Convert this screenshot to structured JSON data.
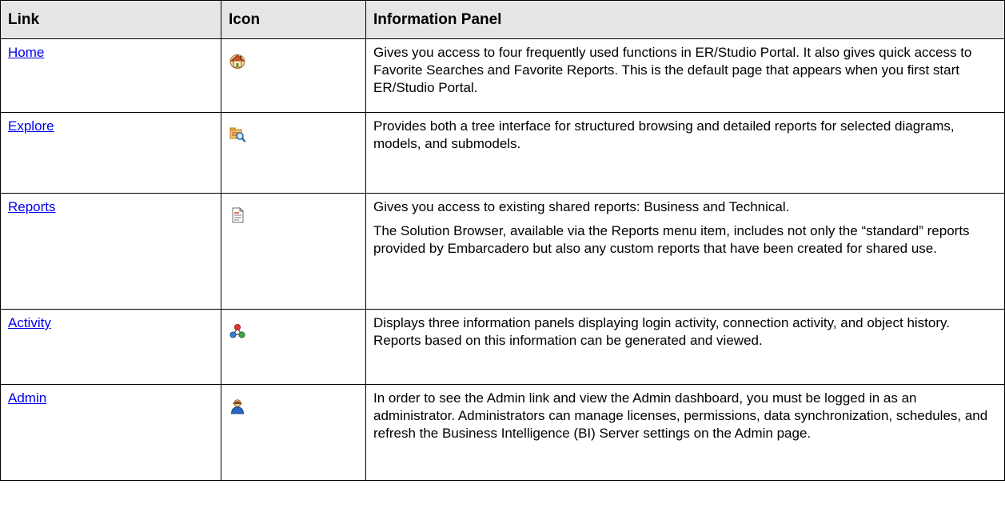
{
  "table": {
    "headers": {
      "link": "Link",
      "icon": "Icon",
      "info": "Information Panel"
    },
    "rows": [
      {
        "link": "Home",
        "icon": "home-icon",
        "info": [
          "Gives you access to four frequently used functions in ER/Studio Portal. It also gives quick access to Favorite Searches and Favorite Reports. This is the default page that appears when you first start ER/Studio Portal."
        ]
      },
      {
        "link": "Explore",
        "icon": "explore-icon",
        "info": [
          "Provides both a tree interface for structured browsing and detailed reports for selected diagrams, models, and submodels."
        ]
      },
      {
        "link": "Reports",
        "icon": "reports-icon",
        "info": [
          "Gives you access to existing shared reports: Business and Technical.",
          "The Solution Browser, available via the Reports menu item, includes not only the “standard” reports provided by Embarcadero but also any custom reports that have been created for shared use."
        ]
      },
      {
        "link": "Activity",
        "icon": "activity-icon",
        "info": [
          "Displays three information panels displaying login activity, connection activity, and object history. Reports based on this information can be generated and viewed."
        ]
      },
      {
        "link": "Admin",
        "icon": "admin-icon",
        "info": [
          "In order to see the Admin link and view the Admin dashboard, you must be logged in as an administrator. Administrators can manage licenses, permissions, data synchronization, schedules, and refresh the Business Intelligence (BI) Server settings on the Admin page."
        ]
      }
    ]
  },
  "colors": {
    "header_bg": "#e6e6e6",
    "link": "#0000ee",
    "border": "#000000"
  }
}
